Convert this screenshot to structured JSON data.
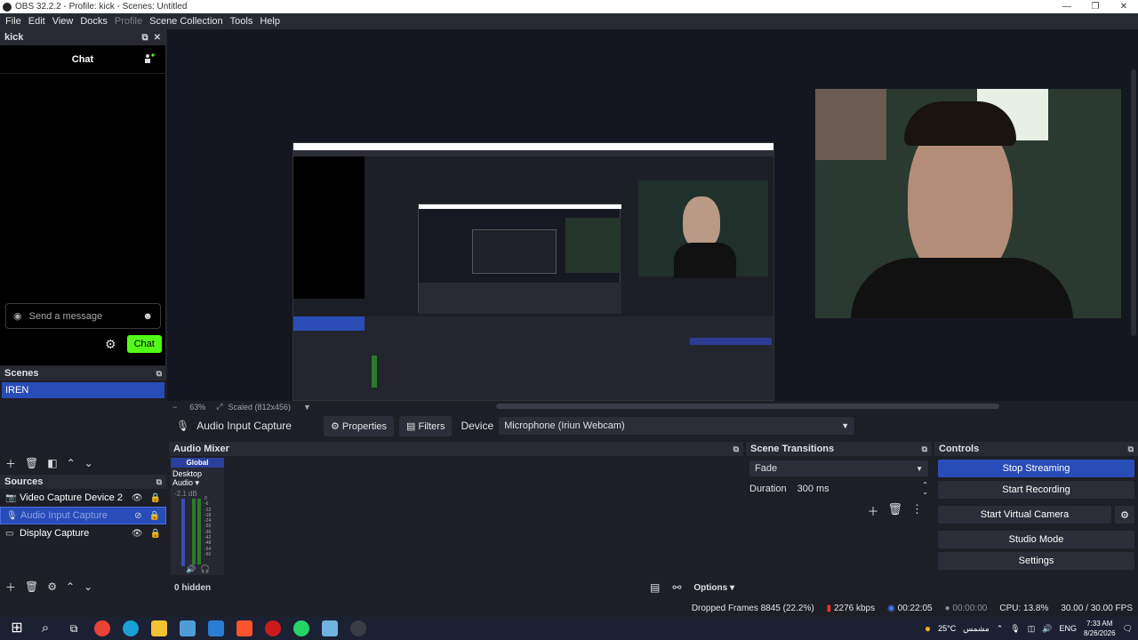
{
  "window": {
    "title": "OBS 32.2.2 - Profile: kick - Scenes: Untitled",
    "controls": [
      "—",
      "❐",
      "✕"
    ]
  },
  "menu": [
    "File",
    "Edit",
    "View",
    "Docks",
    "Profile",
    "Scene Collection",
    "Tools",
    "Help"
  ],
  "chat_dock": {
    "title": "kick",
    "header": "Chat",
    "placeholder": "Send a message",
    "send_label": "Chat"
  },
  "preview": {
    "zoom": "63%",
    "scale": "Scaled (812x456)"
  },
  "source_bar": {
    "source": "Audio Input Capture",
    "properties": "Properties",
    "filters": "Filters",
    "device_label": "Device",
    "device_value": "Microphone (Iriun Webcam)"
  },
  "scenes": {
    "title": "Scenes",
    "items": [
      "IREN"
    ]
  },
  "sources": {
    "title": "Sources",
    "items": [
      "Video Capture Device 2",
      "Audio Input Capture",
      "Display Capture"
    ]
  },
  "mixer": {
    "title": "Audio Mixer",
    "global": "Global",
    "device": "Desktop Audio",
    "db": "-2.1 dB",
    "scale": [
      "0",
      "-6",
      "-12",
      "-18",
      "-24",
      "-30",
      "-36",
      "-42",
      "-48",
      "-54",
      "-60"
    ],
    "hidden": "0 hidden",
    "options": "Options"
  },
  "transitions": {
    "title": "Scene Transitions",
    "selected": "Fade",
    "duration_label": "Duration",
    "duration_value": "300 ms"
  },
  "controls": {
    "title": "Controls",
    "stop_streaming": "Stop Streaming",
    "start_recording": "Start Recording",
    "start_virtual_camera": "Start Virtual Camera",
    "studio_mode": "Studio Mode",
    "settings": "Settings"
  },
  "status": {
    "dropped": "Dropped Frames 8845 (22.2%)",
    "bitrate": "2276 kbps",
    "stream_time": "00:22:05",
    "rec_time": "00:00:00",
    "cpu": "CPU: 13.8%",
    "fps": "30.00 / 30.00 FPS"
  },
  "taskbar": {
    "weather": "25°C",
    "weather_text": "مشمس",
    "lang": "ENG",
    "time": "7:33 AM",
    "date": "8/26/2026"
  }
}
